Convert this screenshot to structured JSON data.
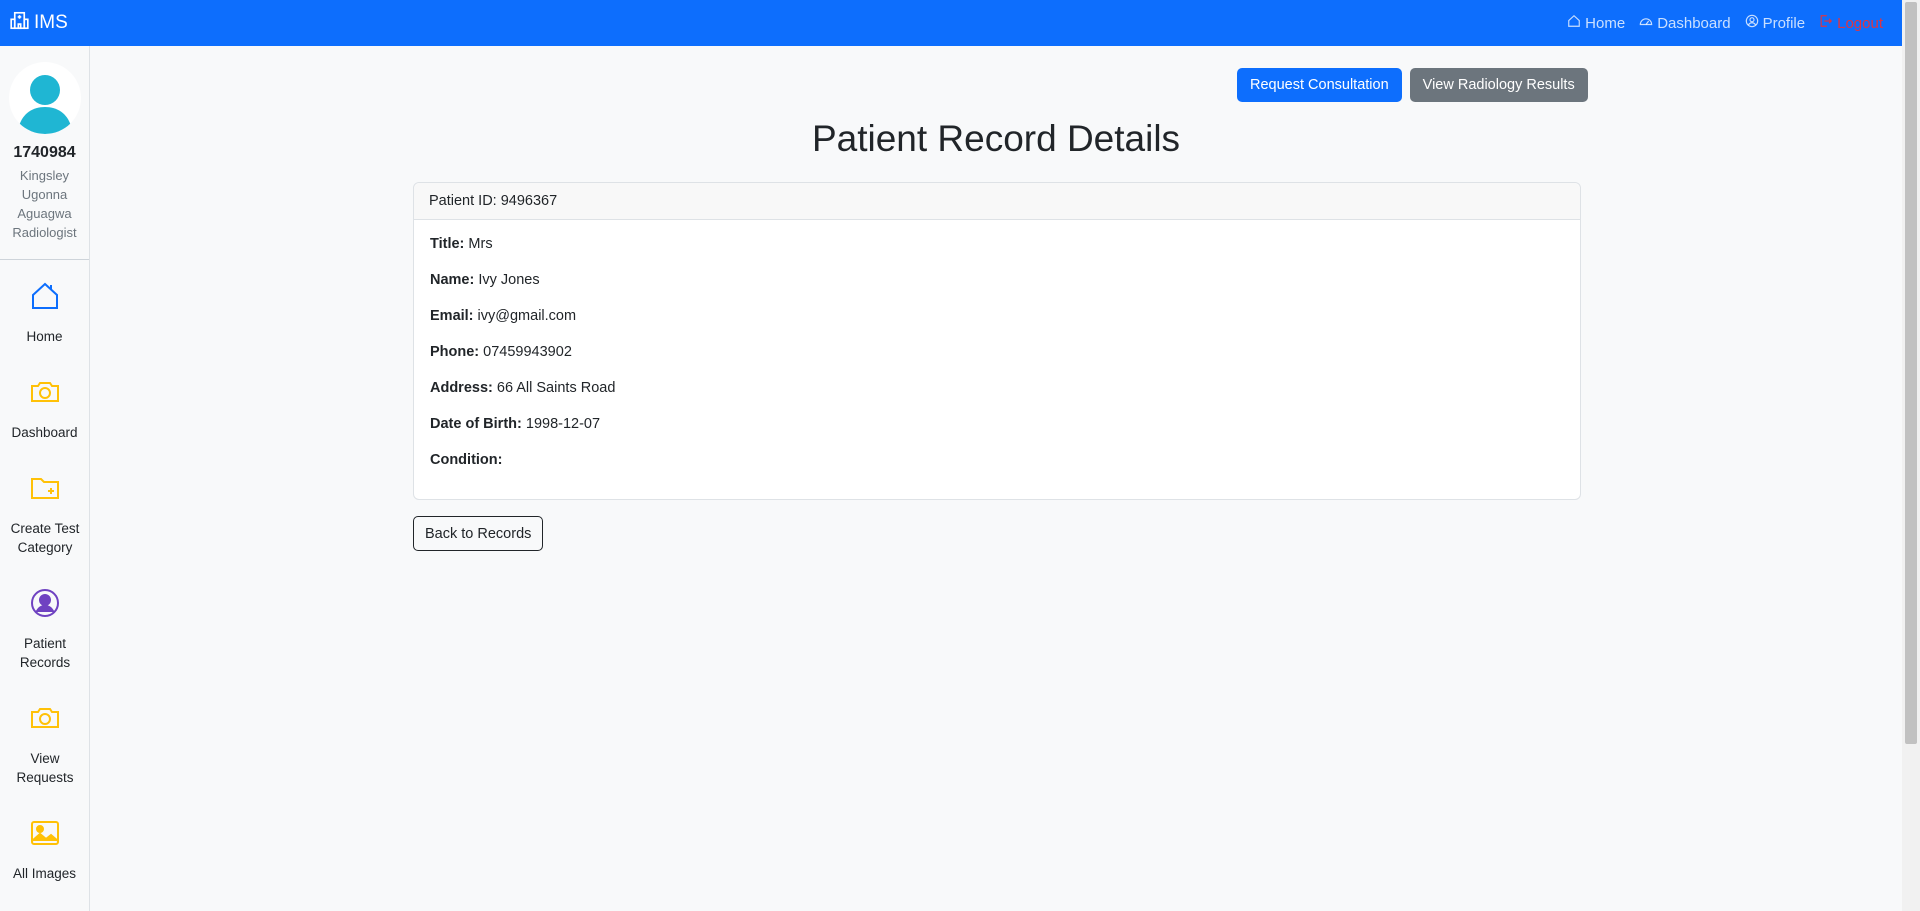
{
  "navbar": {
    "brand": "IMS",
    "links": [
      {
        "label": "Home",
        "icon": "house-icon"
      },
      {
        "label": "Dashboard",
        "icon": "speedometer-icon"
      },
      {
        "label": "Profile",
        "icon": "user-circle-icon"
      },
      {
        "label": "Logout",
        "icon": "logout-icon"
      }
    ]
  },
  "sidebar": {
    "staff_id": "1740984",
    "name_line1": "Kingsley",
    "name_line2": "Ugonna",
    "name_line3": "Aguagwa",
    "role": "Radiologist",
    "items": [
      {
        "label": "Home",
        "icon": "house-icon",
        "color": "#0d6efd"
      },
      {
        "label": "Dashboard",
        "icon": "camera-icon",
        "color": "#ffc107"
      },
      {
        "label": "Create Test Category",
        "icon": "folder-plus-icon",
        "color": "#ffc107"
      },
      {
        "label": "Patient Records",
        "icon": "user-circle-icon",
        "color": "#6f42c1"
      },
      {
        "label": "View Requests",
        "icon": "camera-icon",
        "color": "#ffc107"
      },
      {
        "label": "All Images",
        "icon": "image-icon",
        "color": "#ffc107"
      }
    ]
  },
  "actions": {
    "request_consultation": "Request Consultation",
    "view_radiology_results": "View Radiology Results"
  },
  "page": {
    "title": "Patient Record Details",
    "patient_id_label": "Patient ID:",
    "patient_id": "9496367",
    "back_button": "Back to Records"
  },
  "record": {
    "title_label": "Title:",
    "title": "Mrs",
    "name_label": "Name:",
    "name": "Ivy Jones",
    "email_label": "Email:",
    "email": "ivy@gmail.com",
    "phone_label": "Phone:",
    "phone": "07459943902",
    "address_label": "Address:",
    "address": "66 All Saints Road",
    "dob_label": "Date of Birth:",
    "dob": "1998-12-07",
    "condition_label": "Condition:",
    "condition": ""
  },
  "colors": {
    "primary": "#0d6efd",
    "secondary": "#6c757d",
    "danger": "#dc3545",
    "warning": "#ffc107",
    "purple": "#6f42c1",
    "avatar": "#1fb6d3"
  }
}
